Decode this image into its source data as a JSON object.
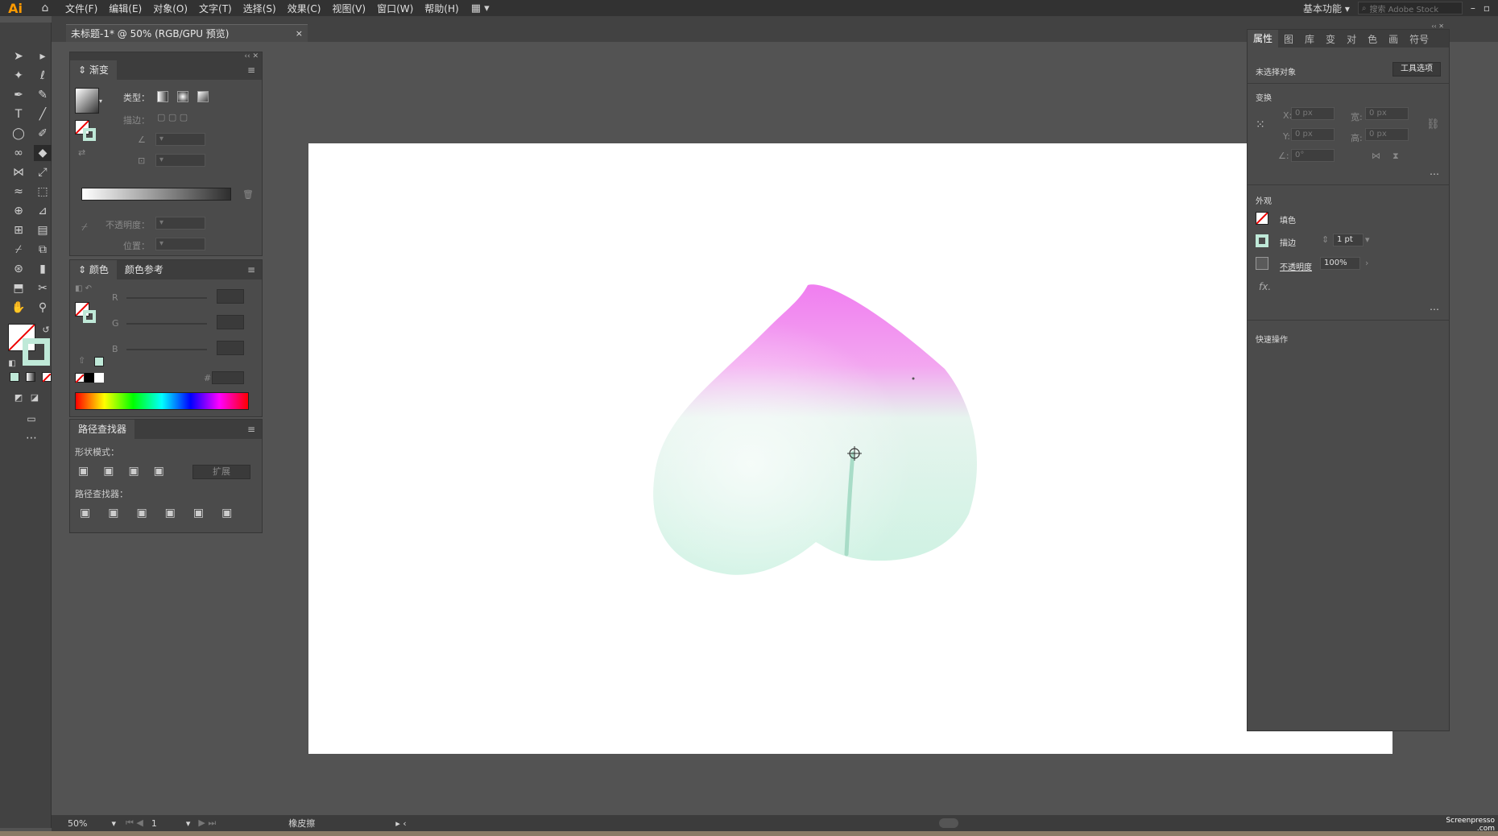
{
  "app": {
    "logo": "Ai",
    "home_icon": "home-icon"
  },
  "menu": [
    "文件(F)",
    "编辑(E)",
    "对象(O)",
    "文字(T)",
    "选择(S)",
    "效果(C)",
    "视图(V)",
    "窗口(W)",
    "帮助(H)"
  ],
  "workspace": {
    "label": "基本功能",
    "search_placeholder": "搜索 Adobe Stock"
  },
  "document_tab": {
    "title": "未标题-1* @ 50% (RGB/GPU 预览)",
    "close": "×"
  },
  "gradient_panel": {
    "title": "渐变",
    "type_label": "类型：",
    "stroke_label": "描边：",
    "opacity_label": "不透明度：",
    "position_label": "位置："
  },
  "color_panel": {
    "tab_color": "颜色",
    "tab_guide": "颜色参考",
    "channels": [
      "R",
      "G",
      "B"
    ],
    "hex_label": "#"
  },
  "pathfinder_panel": {
    "title": "路径查找器",
    "shape_modes": "形状模式：",
    "expand": "扩展",
    "pathfinders": "路径查找器："
  },
  "properties_panel": {
    "tabs": [
      "属性",
      "图",
      "库",
      "变",
      "对",
      "色",
      "画",
      "符号"
    ],
    "no_selection": "未选择对象",
    "tool_options": "工具选项",
    "transform": "变换",
    "x_label": "X:",
    "y_label": "Y:",
    "w_label": "宽:",
    "h_label": "高:",
    "x_val": "0 px",
    "y_val": "0 px",
    "w_val": "0 px",
    "h_val": "0 px",
    "angle_val": "0°",
    "appearance": "外观",
    "fill": "填色",
    "stroke": "描边",
    "stroke_weight": "1 pt",
    "opacity": "不透明度",
    "opacity_val": "100%",
    "fx": "fx.",
    "quick_actions": "快速操作"
  },
  "status": {
    "zoom": "50%",
    "page": "1",
    "tool": "橡皮擦"
  },
  "watermark": "Screenpresso .com",
  "colors": {
    "accent_orange": "#ff9a00",
    "peach_pink": "#ee82ee",
    "peach_mint": "#d9f5ea",
    "stem": "#9fd9c4"
  }
}
